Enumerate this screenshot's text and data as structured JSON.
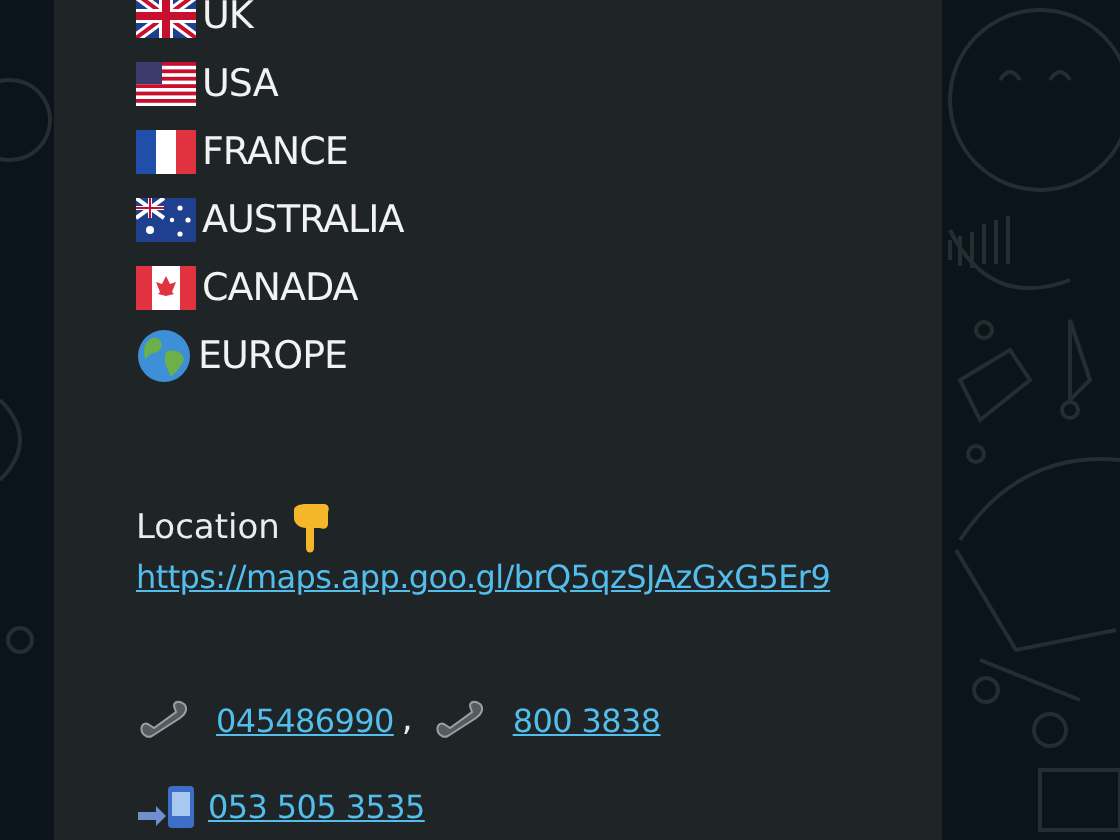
{
  "message": {
    "countries": [
      {
        "name": "UK"
      },
      {
        "name": "USA"
      },
      {
        "name": "FRANCE"
      },
      {
        "name": "AUSTRALIA"
      },
      {
        "name": "CANADA"
      },
      {
        "name": "EUROPE"
      }
    ],
    "location_label": "Location",
    "location_link": "https://maps.app.goo.gl/brQ5qzSJAzGxG5Er9",
    "phones": [
      {
        "number": "045486990",
        "separator": ","
      },
      {
        "number": "800 3838"
      }
    ],
    "mobile": "053 505 3535"
  }
}
